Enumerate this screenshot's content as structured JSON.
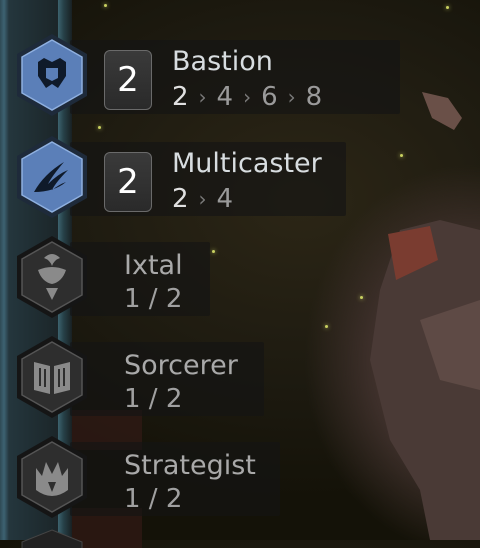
{
  "traits": [
    {
      "name": "Bastion",
      "icon": "bastion-icon",
      "active": true,
      "count": "2",
      "breakpoints": [
        "2",
        "4",
        "6",
        "8"
      ]
    },
    {
      "name": "Multicaster",
      "icon": "multicaster-icon",
      "active": true,
      "count": "2",
      "breakpoints": [
        "2",
        "4"
      ]
    },
    {
      "name": "Ixtal",
      "icon": "ixtal-icon",
      "active": false,
      "progress": "1 / 2"
    },
    {
      "name": "Sorcerer",
      "icon": "sorcerer-icon",
      "active": false,
      "progress": "1 / 2"
    },
    {
      "name": "Strategist",
      "icon": "strategist-icon",
      "active": false,
      "progress": "1 / 2"
    }
  ],
  "colors": {
    "active_hex": "#5b7fb8",
    "inactive_hex": "#3a3a3a",
    "badge_bg": "#2e2e2e"
  }
}
